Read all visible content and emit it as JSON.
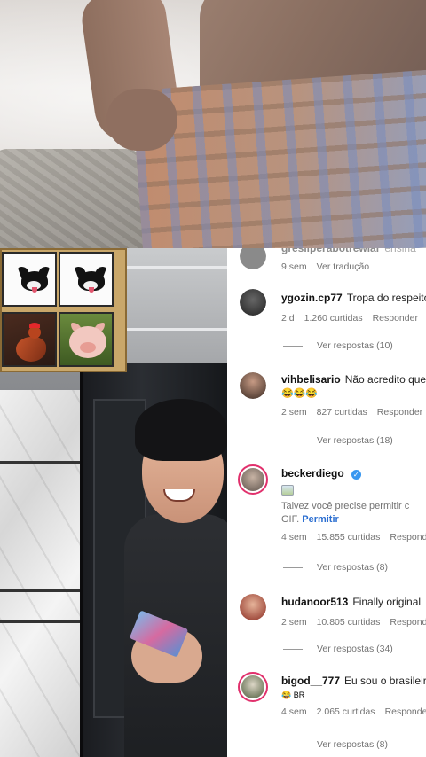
{
  "comments": [
    {
      "username": "gresilperabotrewlar",
      "text": "ensina",
      "time": "9 sem",
      "action": "Ver tradução",
      "avatar_color": "#8a8a8a"
    },
    {
      "username": "ygozin.cp77",
      "text": "Tropa do respeito",
      "time": "2 d",
      "likes": "1.260 curtidas",
      "reply": "Responder",
      "replies": "Ver respostas (10)",
      "avatar_color": "#2a2a2a"
    },
    {
      "username": "vihbelisario",
      "text": "Não acredito que",
      "emoji": "😂😂😂",
      "time": "2 sem",
      "likes": "827 curtidas",
      "reply": "Responder",
      "replies": "Ver respostas (18)",
      "avatar_color": "#6b4a3c"
    },
    {
      "username": "beckerdiego",
      "verified": true,
      "permit_text": "Talvez você precise permitir c",
      "permit_gif": "GIF.",
      "permit_link": "Permitir",
      "time": "4 sem",
      "likes": "15.855 curtidas",
      "reply": "Responder",
      "replies": "Ver respostas (8)",
      "avatar_color": "#9a8a7e"
    },
    {
      "username": "hudanoor513",
      "text": "Finally original",
      "time": "2 sem",
      "likes": "10.805 curtidas",
      "reply": "Responder",
      "replies": "Ver respostas (34)",
      "avatar_color": "#b8392c"
    },
    {
      "username": "bigod__777",
      "text": "Eu sou o brasileiro",
      "emoji": "😂 BR",
      "time": "4 sem",
      "likes": "2.065 curtidas",
      "reply": "Responder",
      "replies": "Ver respostas (8)",
      "avatar_color": "#6e7c5a"
    }
  ],
  "colors": {
    "verified": "#3897f0",
    "story_ring": "#e1306c",
    "link": "#2c6fd1",
    "meta_text": "#737373"
  }
}
